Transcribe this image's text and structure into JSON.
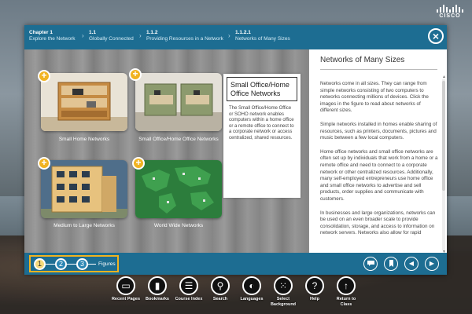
{
  "brand": {
    "name": "CISCO"
  },
  "breadcrumb": {
    "items": [
      {
        "num": "Chapter 1",
        "title": "Explore the Network"
      },
      {
        "num": "1.1",
        "title": "Globally Connected"
      },
      {
        "num": "1.1.2",
        "title": "Providing Resources in a Network"
      },
      {
        "num": "1.1.2.1",
        "title": "Networks of Many Sizes"
      }
    ]
  },
  "close_icon": "×",
  "figures": {
    "plus_icon": "+",
    "items": [
      {
        "caption": "Small Home Networks"
      },
      {
        "caption": "Small Office/Home Office Networks"
      },
      {
        "caption": "Medium to Large Networks"
      },
      {
        "caption": "World Wide Networks"
      }
    ]
  },
  "popup": {
    "title": "Small Office/Home Office Networks",
    "body": "The Small Office/Home Office or SOHO network enables computers within a home office or a remote office to connect to a corporate network or access centralized, shared resources."
  },
  "panel": {
    "title": "Networks of Many Sizes",
    "paragraphs": [
      "Networks come in all sizes. They can range from simple networks consisting of two computers to networks connecting millions of devices. Click the images in the figure to read about networks of different sizes.",
      "Simple networks installed in homes enable sharing of resources, such as printers, documents, pictures and music between a few local computers.",
      "Home office networks and small office networks are often set up by individuals that work from a home or a remote office and need to connect to a corporate network or other centralized resources. Additionally, many self-employed entrepreneurs use home office and small office networks to advertise and sell products, order supplies and communicate with customers.",
      "In businesses and large organizations, networks can be used on an even broader scale to provide consolidation, storage, and access to information on network servers. Networks also allow for rapid"
    ]
  },
  "steps": {
    "items": [
      "1",
      "2",
      "3"
    ],
    "active_index": 0,
    "label": "Figures"
  },
  "nav_icons": {
    "comment": "comment-icon",
    "bookmark": "bookmark-icon",
    "prev": "◀",
    "next": "▶"
  },
  "toolbar": {
    "items": [
      {
        "label": "Recent Pages",
        "icon": "▭"
      },
      {
        "label": "Bookmarks",
        "icon": "▮"
      },
      {
        "label": "Course Index",
        "icon": "☰"
      },
      {
        "label": "Search",
        "icon": "⚲"
      },
      {
        "label": "Languages",
        "icon": "◐"
      },
      {
        "label": "Select Background",
        "icon": "⁙"
      },
      {
        "label": "Help",
        "icon": "?"
      },
      {
        "label": "Return to Class",
        "icon": "↑"
      }
    ]
  },
  "colors": {
    "header_blue": "#1d6d92",
    "accent_yellow": "#f1b321"
  }
}
